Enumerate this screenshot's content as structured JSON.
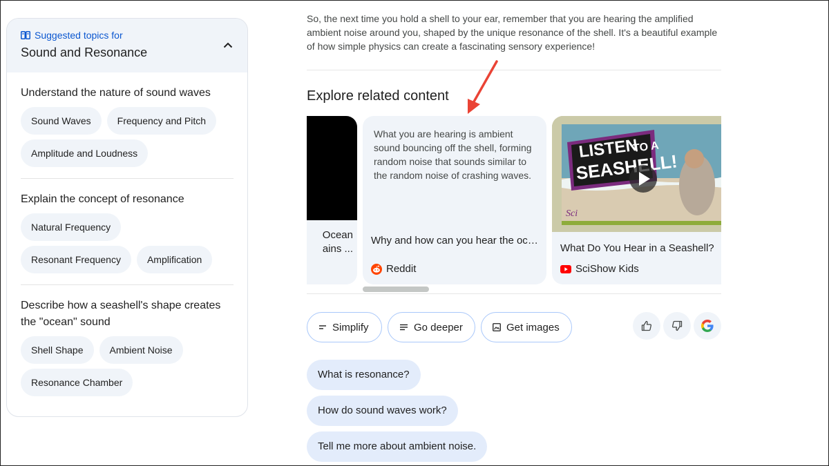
{
  "sidebar": {
    "kicker": "Suggested topics for",
    "title": "Sound and Resonance",
    "sections": [
      {
        "heading": "Understand the nature of sound waves",
        "chips": [
          "Sound Waves",
          "Frequency and Pitch",
          "Amplitude and Loudness"
        ]
      },
      {
        "heading": "Explain the concept of resonance",
        "chips": [
          "Natural Frequency",
          "Resonant Frequency",
          "Amplification"
        ]
      },
      {
        "heading": "Describe how a seashell's shape creates the \"ocean\" sound",
        "chips": [
          "Shell Shape",
          "Ambient Noise",
          "Resonance Chamber"
        ]
      }
    ]
  },
  "main": {
    "intro": "So, the next time you hold a shell to your ear, remember that you are hearing the amplified ambient noise around you, shaped by the unique resonance of the shell. It's a beautiful example of how simple physics can create a fascinating sensory experience!",
    "explore_title": "Explore related content",
    "cards": [
      {
        "title_partial_1": "Ocean",
        "title_partial_2": "ains ..."
      },
      {
        "snippet": "What you are hearing is ambient sound bouncing off the shell, forming random noise that sounds similar to the random noise of crashing waves.",
        "title": "Why and how can you hear the oce...",
        "source": "Reddit"
      },
      {
        "thumb_text_1": "LISTEN",
        "thumb_text_2": "TO A",
        "thumb_text_3": "SEASHELL!",
        "title": "What Do You Hear in a Seashell?",
        "source": "SciShow Kids"
      }
    ],
    "actions": {
      "simplify": "Simplify",
      "go_deeper": "Go deeper",
      "get_images": "Get images"
    },
    "followups": [
      "What is resonance?",
      "How do sound waves work?",
      "Tell me more about ambient noise."
    ]
  },
  "colors": {
    "accent": "#0b57d0",
    "chip_bg": "#f0f4f9",
    "followup_bg": "#e3ecfb",
    "annotation_arrow": "#ea4335"
  }
}
